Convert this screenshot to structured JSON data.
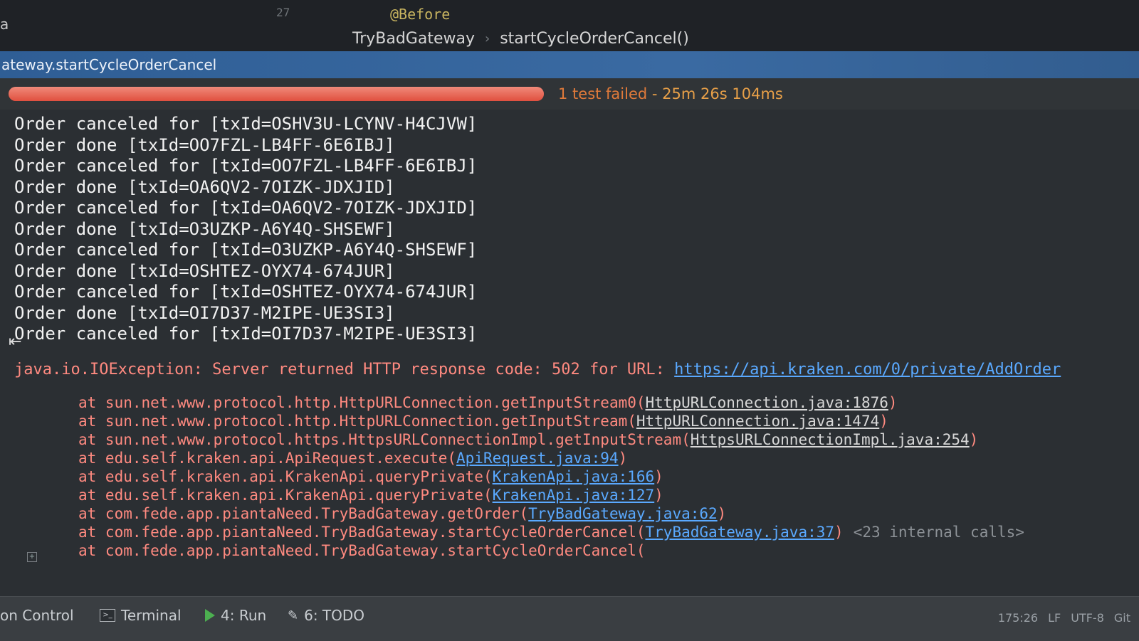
{
  "editor": {
    "left_fragment": "a",
    "gutter_number": "27",
    "annotation": "@Before",
    "breadcrumb": [
      "TryBadGateway",
      "startCycleOrderCancel()"
    ],
    "breadcrumb_separator": "›"
  },
  "run_tab": {
    "label": "ateway.startCycleOrderCancel"
  },
  "test_status": {
    "progress_fraction": 1.0,
    "text": "1 test failed",
    "duration": "- 25m 26s 104ms"
  },
  "console": {
    "log_lines": [
      "Order canceled for [txId=OSHV3U-LCYNV-H4CJVW]",
      "Order done [txId=OO7FZL-LB4FF-6E6IBJ]",
      "Order canceled for [txId=OO7FZL-LB4FF-6E6IBJ]",
      "Order done [txId=OA6QV2-7OIZK-JDXJID]",
      "Order canceled for [txId=OA6QV2-7OIZK-JDXJID]",
      "Order done [txId=O3UZKP-A6Y4Q-SHSEWF]",
      "Order canceled for [txId=O3UZKP-A6Y4Q-SHSEWF]",
      "Order done [txId=OSHTEZ-OYX74-674JUR]",
      "Order canceled for [txId=OSHTEZ-OYX74-674JUR]",
      "Order done [txId=OI7D37-M2IPE-UE3SI3]",
      "Order canceled for [txId=OI7D37-M2IPE-UE3SI3]"
    ],
    "exception": {
      "text": "java.io.IOException: Server returned HTTP response code: 502 for URL: ",
      "url": "https://api.kraken.com/0/private/AddOrder"
    },
    "stack": [
      {
        "method": "at sun.net.www.protocol.http.HttpURLConnection.getInputStream0(",
        "source": "HttpURLConnection.java:1876",
        "close": ")",
        "kind": "lib",
        "extra": ""
      },
      {
        "method": "at sun.net.www.protocol.http.HttpURLConnection.getInputStream(",
        "source": "HttpURLConnection.java:1474",
        "close": ")",
        "kind": "lib",
        "extra": ""
      },
      {
        "method": "at sun.net.www.protocol.https.HttpsURLConnectionImpl.getInputStream(",
        "source": "HttpsURLConnectionImpl.java:254",
        "close": ")",
        "kind": "lib",
        "extra": ""
      },
      {
        "method": "at edu.self.kraken.api.ApiRequest.execute(",
        "source": "ApiRequest.java:94",
        "close": ")",
        "kind": "proj",
        "extra": ""
      },
      {
        "method": "at edu.self.kraken.api.KrakenApi.queryPrivate(",
        "source": "KrakenApi.java:166",
        "close": ")",
        "kind": "proj",
        "extra": ""
      },
      {
        "method": "at edu.self.kraken.api.KrakenApi.queryPrivate(",
        "source": "KrakenApi.java:127",
        "close": ")",
        "kind": "proj",
        "extra": ""
      },
      {
        "method": "at com.fede.app.piantaNeed.TryBadGateway.getOrder(",
        "source": "TryBadGateway.java:62",
        "close": ")",
        "kind": "proj",
        "extra": ""
      },
      {
        "method": "at com.fede.app.piantaNeed.TryBadGateway.startCycleOrderCancel(",
        "source": "TryBadGateway.java:37",
        "close": ")",
        "kind": "proj",
        "extra": "<23 internal calls>"
      },
      {
        "method": "at com.fede.app.piantaNeed.TryBadGateway.startCycleOrderCancel(",
        "source": "",
        "close": "",
        "kind": "proj",
        "extra": ""
      }
    ]
  },
  "bottom_bar": {
    "version_control": "on Control",
    "terminal": "Terminal",
    "run": "4: Run",
    "todo": "6: TODO",
    "position": "175:26",
    "line_sep": "LF",
    "encoding": "UTF-8",
    "vcs": "Git"
  },
  "colors": {
    "progress_fail": "#e0503f",
    "link": "#5aa9ff",
    "error": "#ff8a80",
    "status": "#e8a048"
  }
}
